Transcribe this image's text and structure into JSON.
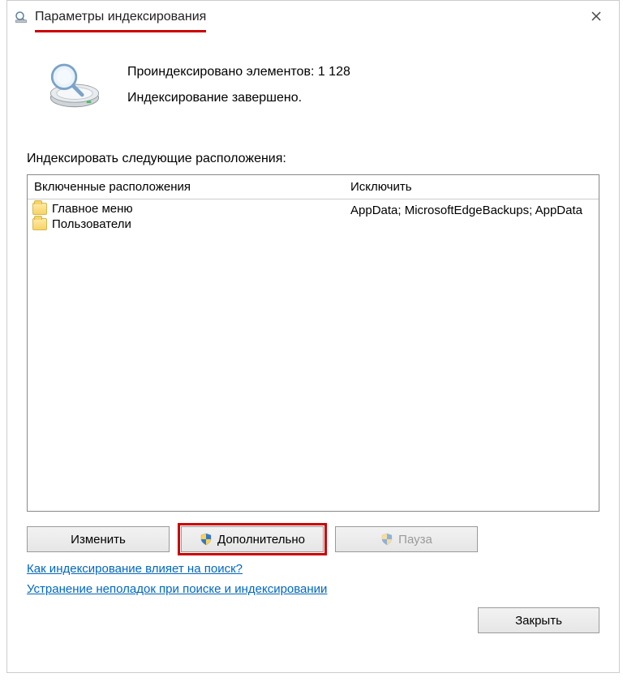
{
  "titlebar": {
    "title": "Параметры индексирования"
  },
  "status": {
    "line1": "Проиндексировано элементов: 1 128",
    "line2": "Индексирование завершено."
  },
  "section_label": "Индексировать следующие расположения:",
  "columns": {
    "included": "Включенные расположения",
    "excluded": "Исключить"
  },
  "locations": {
    "included": [
      "Главное меню",
      "Пользователи"
    ],
    "excluded": [
      "",
      "AppData; MicrosoftEdgeBackups; AppData"
    ]
  },
  "buttons": {
    "modify": "Изменить",
    "advanced": "Дополнительно",
    "pause": "Пауза",
    "close": "Закрыть"
  },
  "links": {
    "how_affects_search": "Как индексирование влияет на поиск?",
    "troubleshoot": "Устранение неполадок при поиске и индексировании"
  },
  "icons": {
    "app": "indexing-magnifier-icon",
    "close": "close-icon",
    "drive": "hard-drive-magnifier-icon",
    "folder": "folder-icon",
    "shield": "uac-shield-icon"
  },
  "colors": {
    "highlight": "#cc0000",
    "link": "#0067c0"
  }
}
